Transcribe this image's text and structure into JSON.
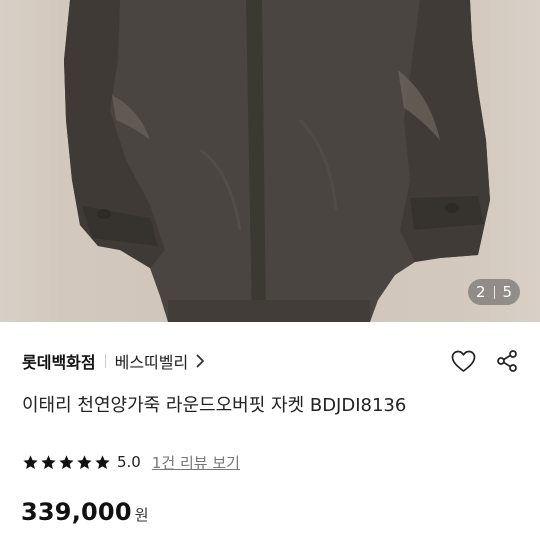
{
  "gallery": {
    "current_page": "2",
    "total_pages": "5",
    "image_subject": "dark leather jacket photo"
  },
  "product": {
    "brand": "롯데백화점",
    "seller": "베스띠벨리",
    "title": "이태리 천연양가죽 라운드오버핏 자켓 BDJDI8136",
    "rating_score": "5.0",
    "review_link": "1건 리뷰 보기",
    "rating_stars": 5,
    "price": "339,000",
    "price_unit": "원"
  },
  "icons": {
    "wishlist": "heart-icon",
    "share": "share-icon",
    "seller_chevron": "chevron-right-icon",
    "star": "star-icon"
  },
  "colors": {
    "jacket": "#4c4640",
    "background": "#cfc5ba",
    "star": "#111111"
  }
}
